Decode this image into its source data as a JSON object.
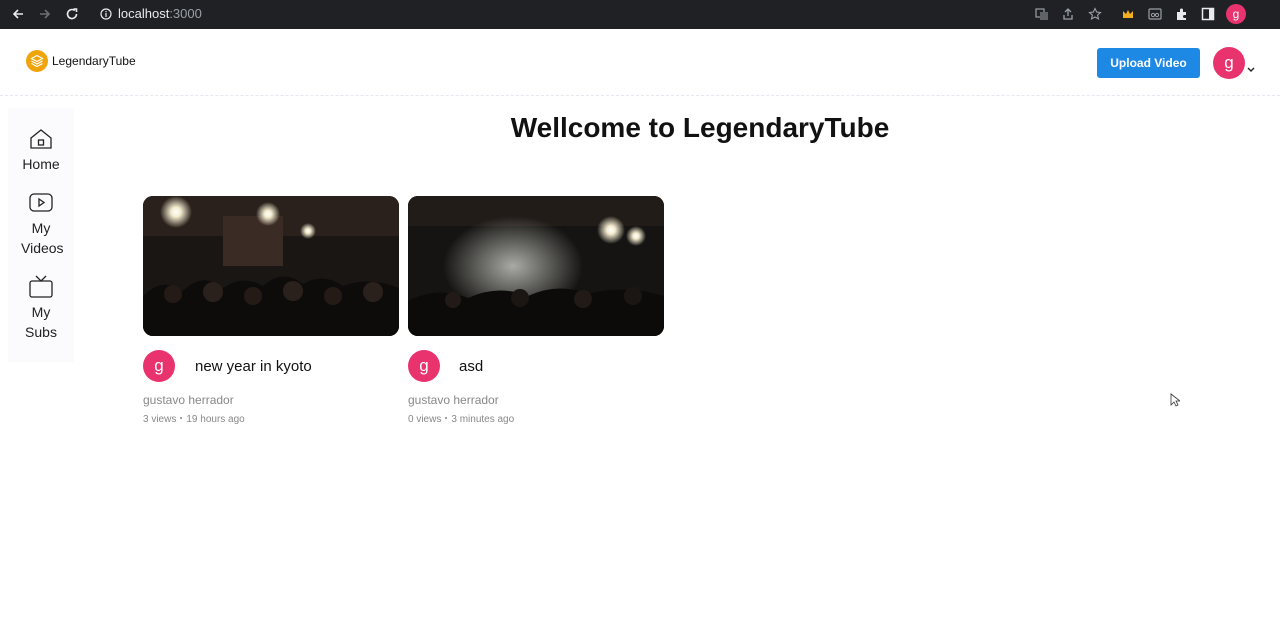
{
  "browser": {
    "url_host": "localhost",
    "url_port": ":3000",
    "profile_initial": "g"
  },
  "header": {
    "logo_text": "LegendaryTube",
    "upload_label": "Upload Video",
    "avatar_initial": "g"
  },
  "sidebar": {
    "items": [
      {
        "label": "Home",
        "icon": "home-icon"
      },
      {
        "label": "My Videos",
        "icon": "play-icon"
      },
      {
        "label": "My Subs",
        "icon": "tv-icon"
      }
    ]
  },
  "main": {
    "title": "Wellcome to LegendaryTube",
    "videos": [
      {
        "title": "new year in kyoto",
        "author": "gustavo herrador",
        "views": "3 views",
        "time": "19 hours ago",
        "avatar_initial": "g"
      },
      {
        "title": "asd",
        "author": "gustavo herrador",
        "views": "0 views",
        "time": "3 minutes ago",
        "avatar_initial": "g"
      }
    ]
  },
  "colors": {
    "accent": "#1e88e5",
    "avatar": "#e8336f",
    "logo": "#f0a40c"
  }
}
